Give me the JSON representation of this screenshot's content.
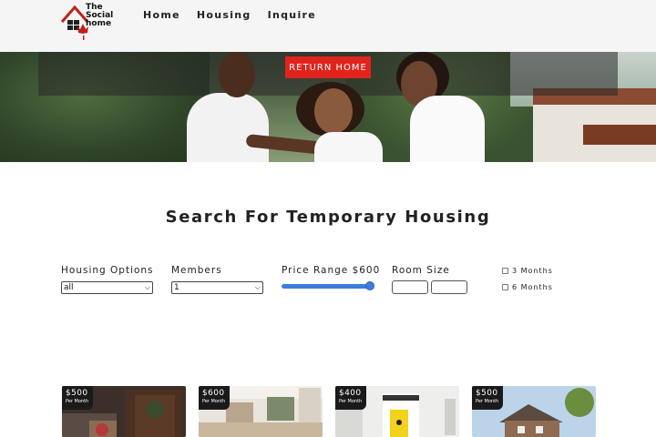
{
  "header": {
    "logo_text": [
      "The",
      "Social",
      "home"
    ],
    "nav": [
      "Home",
      "Housing",
      "Inquire"
    ]
  },
  "hero": {
    "return_label": "RETURN HOME"
  },
  "main": {
    "title": "Search For Temporary Housing",
    "filters": {
      "housing_options": {
        "label": "Housing Options",
        "value": "all"
      },
      "members": {
        "label": "Members",
        "value": "1"
      },
      "price_range": {
        "label": "Price Range $600",
        "value": 600,
        "fraction": 0.95
      },
      "room_size": {
        "label": "Room Size"
      },
      "duration": [
        {
          "label": "3 Months",
          "checked": false
        },
        {
          "label": "6 Months",
          "checked": false
        }
      ]
    }
  },
  "listings": [
    {
      "price": "$500",
      "period": "Per Month"
    },
    {
      "price": "$600",
      "period": "Per Month"
    },
    {
      "price": "$400",
      "period": "Per Month"
    },
    {
      "price": "$500",
      "period": "Per Month"
    }
  ],
  "colors": {
    "accent_red": "#e0241b",
    "slider_blue": "#3b7ddd",
    "header_bg": "#f5f5f5"
  }
}
